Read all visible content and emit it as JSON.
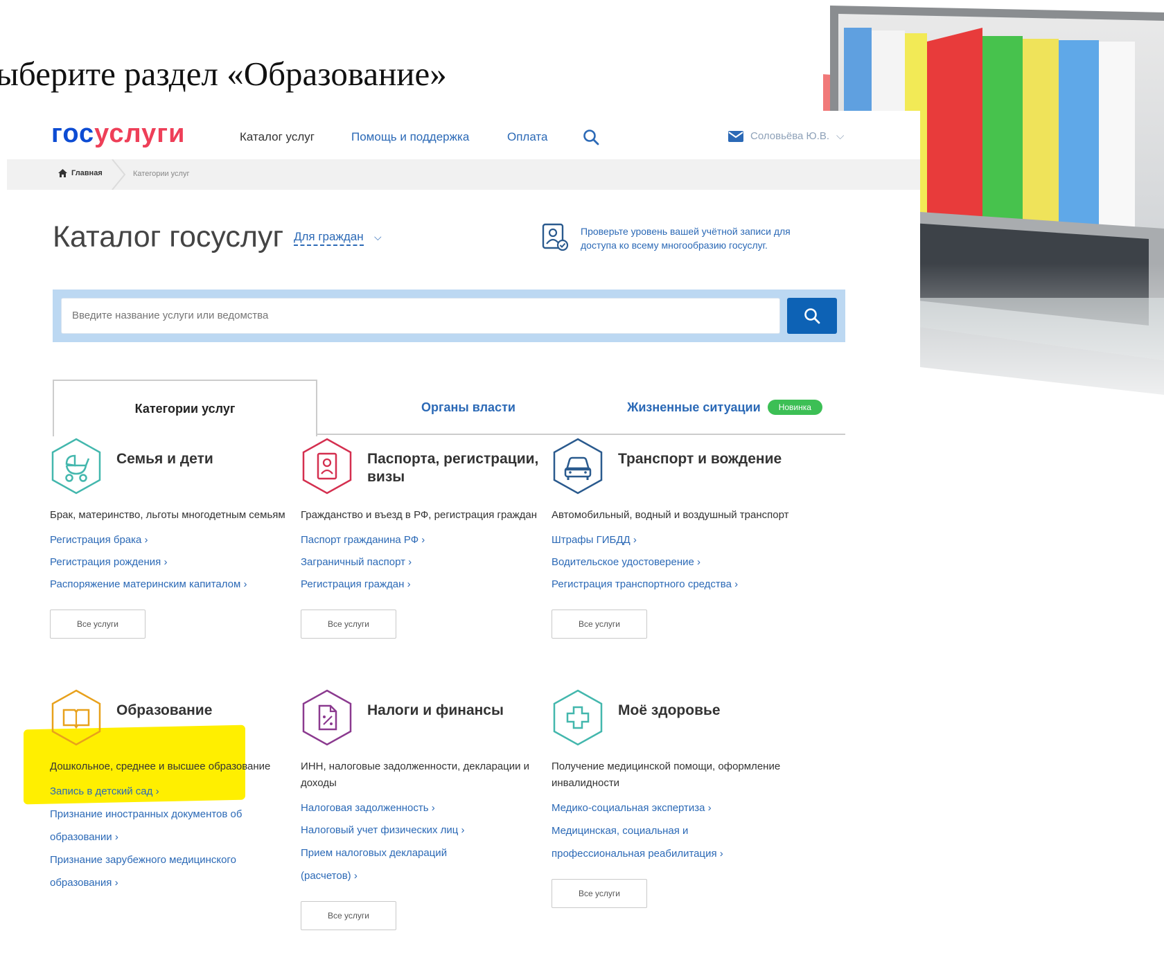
{
  "slide_heading": "ыберите раздел «Образование»",
  "header": {
    "logo_part1": "гос",
    "logo_part2": "услуги",
    "nav_catalog": "Каталог услуг",
    "nav_help": "Помощь и поддержка",
    "nav_payment": "Оплата",
    "user_name": "Соловьёва Ю.В.",
    "user_caret": "⌵"
  },
  "breadcrumb": {
    "home": "Главная",
    "current": "Категории услуг"
  },
  "catalog": {
    "title": "Каталог госуслуг",
    "audience": "Для граждан",
    "audience_caret": "⌵",
    "account_notice": "Проверьте уровень вашей учётной записи для доступа ко всему многообразию госуслуг."
  },
  "search": {
    "placeholder": "Введите название услуги или ведомства"
  },
  "tabs": {
    "categories": "Категории услуг",
    "authorities": "Органы власти",
    "life_situations": "Жизненные ситуации",
    "new_badge": "Новинка"
  },
  "categories": [
    {
      "title": "Семья и дети",
      "description": "Брак, материнство, льготы многодетным семьям",
      "links": [
        "Регистрация брака ›",
        "Регистрация рождения ›",
        "Распоряжение материнским капиталом ›"
      ],
      "all_label": "Все услуги",
      "icon_color": "#43b7ad"
    },
    {
      "title": "Паспорта, регистрации, визы",
      "description": "Гражданство и въезд в РФ, регистрация граждан",
      "links": [
        "Паспорт гражданина РФ ›",
        "Заграничный паспорт ›",
        "Регистрация граждан ›"
      ],
      "all_label": "Все услуги",
      "icon_color": "#d42f4f"
    },
    {
      "title": "Транспорт и вождение",
      "description": "Автомобильный, водный и воздушный транспорт",
      "links": [
        "Штрафы ГИБДД ›",
        "Водительское удостоверение ›",
        "Регистрация транспортного средства ›"
      ],
      "all_label": "Все услуги",
      "icon_color": "#2a5a8e"
    },
    {
      "title": "Образование",
      "description": "Дошкольное, среднее и высшее образование",
      "links": [
        "Запись в детский сад ›",
        "Признание иностранных документов об образовании ›",
        "Признание зарубежного медицинского образования ›"
      ],
      "all_label": "",
      "icon_color": "#e8a11c",
      "highlight_color": "#ffef00"
    },
    {
      "title": "Налоги и финансы",
      "description": "ИНН, налоговые задолженности, декларации и доходы",
      "links": [
        "Налоговая задолженность ›",
        "Налоговый учет физических лиц ›",
        "Прием налоговых деклараций (расчетов) ›"
      ],
      "all_label": "Все услуги",
      "icon_color": "#8b3a8f"
    },
    {
      "title": "Моё здоровье",
      "description": "Получение медицинской помощи, оформление инвалидности",
      "links": [
        "Медико-социальная экспертиза ›",
        "Медицинская, социальная и профессиональная реабилитация ›"
      ],
      "all_label": "Все услуги",
      "icon_color": "#43b7ad"
    }
  ],
  "colors": {
    "accent_blue": "#2b69b6",
    "search_button": "#0d62b5",
    "badge_green": "#3cbf55"
  }
}
